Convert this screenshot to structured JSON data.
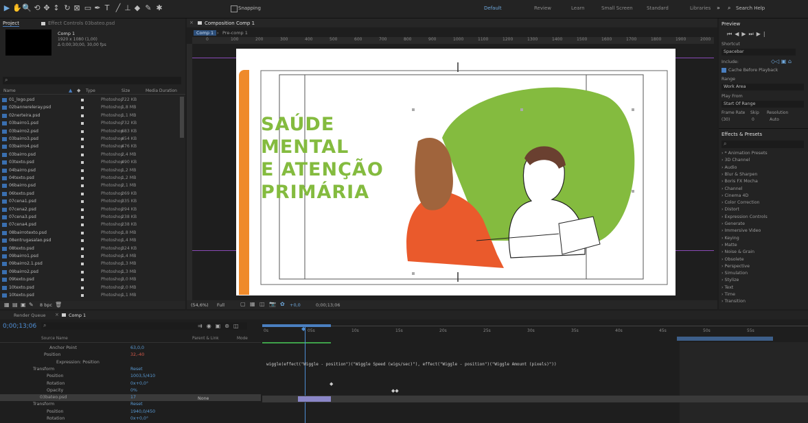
{
  "workspaces": [
    "Default",
    "Review",
    "Learn",
    "Small Screen",
    "Standard",
    "Libraries"
  ],
  "snapping_label": "Snapping",
  "search_help": "Search Help",
  "project": {
    "tab": "Project",
    "effect_controls_tab": "Effect Controls 03bateo.psd",
    "comp_name": "Comp 1",
    "comp_info_1": "1920 x 1080 (1,00)",
    "comp_info_2": "Δ 0;00;30;00, 30,00 fps",
    "search_placeholder": "",
    "columns": [
      "Name",
      "Type",
      "Size",
      "Media Duration"
    ],
    "items": [
      {
        "name": "01_logo.psd",
        "type": "Photoshop",
        "size": "722 KB"
      },
      {
        "name": "02bannereleray.psd",
        "type": "Photoshop",
        "size": "1,8 MB"
      },
      {
        "name": "02nerteira.psd",
        "type": "Photoshop",
        "size": "1,1 MB"
      },
      {
        "name": "03bairro1.psd",
        "type": "Photoshop",
        "size": "732 KB"
      },
      {
        "name": "03bairro2.psd",
        "type": "Photoshop",
        "size": "683 KB"
      },
      {
        "name": "03bairro3.psd",
        "type": "Photoshop",
        "size": "454 KB"
      },
      {
        "name": "03bairro4.psd",
        "type": "Photoshop",
        "size": "476 KB"
      },
      {
        "name": "03bairro.psd",
        "type": "Photoshop",
        "size": "2,4 MB"
      },
      {
        "name": "03texto.psd",
        "type": "Photoshop",
        "size": "490 KB"
      },
      {
        "name": "04bairro.psd",
        "type": "Photoshop",
        "size": "1,2 MB"
      },
      {
        "name": "04texto.psd",
        "type": "Photoshop",
        "size": "1,2 MB"
      },
      {
        "name": "06bairro.psd",
        "type": "Photoshop",
        "size": "2,1 MB"
      },
      {
        "name": "06texto.psd",
        "type": "Photoshop",
        "size": "269 KB"
      },
      {
        "name": "07cena1.psd",
        "type": "Photoshop",
        "size": "335 KB"
      },
      {
        "name": "07cena2.psd",
        "type": "Photoshop",
        "size": "294 KB"
      },
      {
        "name": "07cena3.psd",
        "type": "Photoshop",
        "size": "238 KB"
      },
      {
        "name": "07cena4.psd",
        "type": "Photoshop",
        "size": "238 KB"
      },
      {
        "name": "08bairrotexto.psd",
        "type": "Photoshop",
        "size": "1,8 MB"
      },
      {
        "name": "08entrugasalao.psd",
        "type": "Photoshop",
        "size": "1,4 MB"
      },
      {
        "name": "08texto.psd",
        "type": "Photoshop",
        "size": "324 KB"
      },
      {
        "name": "09bairro1.psd",
        "type": "Photoshop",
        "size": "1,4 MB"
      },
      {
        "name": "09bairro2.1.psd",
        "type": "Photoshop",
        "size": "1,3 MB"
      },
      {
        "name": "09bairro2.psd",
        "type": "Photoshop",
        "size": "1,3 MB"
      },
      {
        "name": "09texto.psd",
        "type": "Photoshop",
        "size": "3,0 MB"
      },
      {
        "name": "10texto.psd",
        "type": "Photoshop",
        "size": "2,0 MB"
      },
      {
        "name": "10texto.psd",
        "type": "Photoshop",
        "size": "1,1 MB"
      }
    ],
    "bpc": "8 bpc"
  },
  "composition": {
    "tab": "Composition Comp 1",
    "breadcrumb": [
      "Comp 1",
      "Pre-comp 1"
    ],
    "ruler": [
      "0",
      "100",
      "200",
      "300",
      "400",
      "500",
      "600",
      "700",
      "800",
      "900",
      "1000",
      "1100",
      "1200",
      "1300",
      "1400",
      "1500",
      "1600",
      "1700",
      "1800",
      "1900",
      "2000"
    ],
    "art_title": [
      "SAÚDE",
      "MENTAL",
      "E ATENÇÃO",
      "PRIMÁRIA"
    ],
    "zoom": "(54,6%)",
    "resolution": "Full",
    "exposure": "+0,0",
    "timecode": "0;00;13;06"
  },
  "preview": {
    "title": "Preview",
    "shortcut_label": "Shortcut",
    "shortcut_value": "Spacebar",
    "include_label": "Include:",
    "cache_label": "Cache Before Playback",
    "range_label": "Range",
    "range_value": "Work Area",
    "play_from_label": "Play From",
    "play_from_value": "Start Of Range",
    "frame_rate_label": "Frame Rate",
    "skip_label": "Skip",
    "resolution_label": "Resolution",
    "frame_rate_value": "(30)",
    "skip_value": "0",
    "resolution_value": "Auto"
  },
  "effects": {
    "title": "Effects & Presets",
    "items": [
      "* Animation Presets",
      "3D Channel",
      "Audio",
      "Blur & Sharpen",
      "Boris FX Mocha",
      "Channel",
      "Cinema 4D",
      "Color Correction",
      "Distort",
      "Expression Controls",
      "Generate",
      "Immersive Video",
      "Keying",
      "Matte",
      "Noise & Grain",
      "Obsolete",
      "Perspective",
      "Simulation",
      "Stylize",
      "Text",
      "Time",
      "Transition"
    ]
  },
  "timeline": {
    "render_queue_tab": "Render Queue",
    "comp_tab": "Comp 1",
    "timecode": "0;00;13;06",
    "ruler": [
      "0s",
      "05s",
      "10s",
      "15s",
      "20s",
      "25s",
      "30s",
      "35s",
      "40s",
      "45s",
      "50s",
      "55s"
    ],
    "columns": [
      "Source Name",
      "Parent & Link",
      "Mode"
    ],
    "rows": [
      {
        "label": "Anchor Point",
        "value": "63,0,0"
      },
      {
        "label": "Position",
        "value": "32,-40"
      },
      {
        "label": "Expression: Position",
        "value": ""
      },
      {
        "label": "Transform",
        "value": "Reset"
      },
      {
        "label": "Position",
        "value": "1003,5/410"
      },
      {
        "label": "Rotation",
        "value": "0x+0,0°"
      },
      {
        "label": "Opacity",
        "value": "0%"
      },
      {
        "label": "03bateo.psd",
        "value": "17"
      },
      {
        "label": "Transform",
        "value": "Reset"
      },
      {
        "label": "Position",
        "value": "1940,0/450"
      },
      {
        "label": "Rotation",
        "value": "0x+0,0°"
      }
    ],
    "expression": "wiggle(effect(\"Wiggle - position\")(\"Wiggle Speed (wigs/sec)\"), effect(\"Wiggle - position\")(\"Wiggle Amount (pixels)\"))",
    "parent_none": "None"
  }
}
